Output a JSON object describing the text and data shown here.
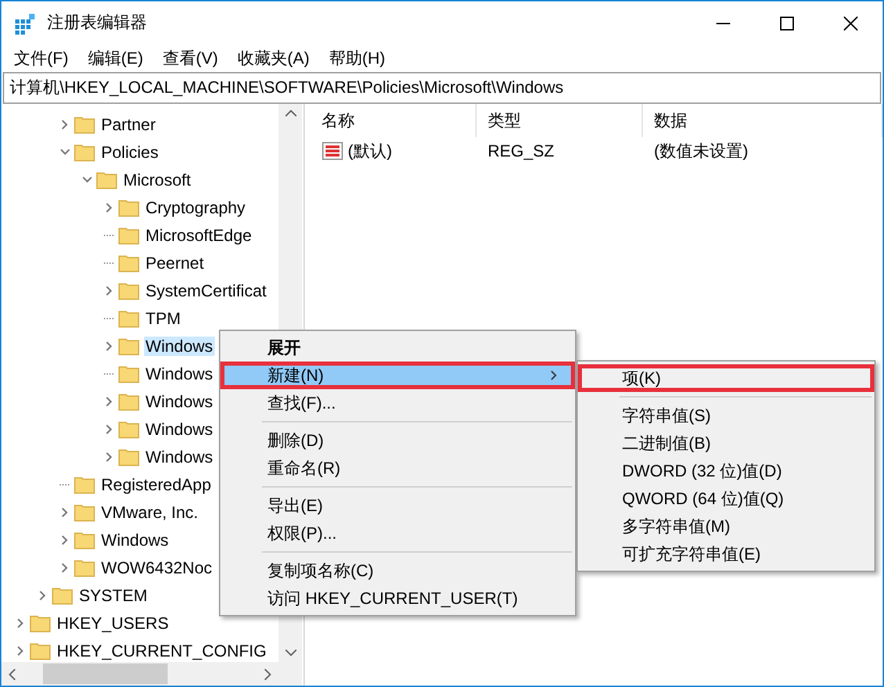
{
  "window": {
    "title": "注册表编辑器"
  },
  "menu_bar": [
    "文件(F)",
    "编辑(E)",
    "查看(V)",
    "收藏夹(A)",
    "帮助(H)"
  ],
  "address_bar": "计算机\\HKEY_LOCAL_MACHINE\\SOFTWARE\\Policies\\Microsoft\\Windows",
  "tree": {
    "software_children": [
      {
        "label": "Partner",
        "kind": "branch",
        "expanded": false,
        "selected": false
      },
      {
        "label": "Policies",
        "kind": "branch",
        "expanded": true,
        "selected": false,
        "children": [
          {
            "label": "Microsoft",
            "kind": "branch",
            "expanded": true,
            "selected": false,
            "children": [
              {
                "label": "Cryptography",
                "kind": "branch",
                "expanded": false,
                "selected": false
              },
              {
                "label": "MicrosoftEdge",
                "kind": "leaf",
                "selected": false
              },
              {
                "label": "Peernet",
                "kind": "leaf",
                "selected": false
              },
              {
                "label": "SystemCertificat",
                "kind": "branch",
                "expanded": false,
                "selected": false
              },
              {
                "label": "TPM",
                "kind": "leaf",
                "selected": false
              },
              {
                "label": "Windows",
                "kind": "branch",
                "expanded": false,
                "selected": true
              },
              {
                "label": "Windows",
                "kind": "leaf",
                "selected": false
              },
              {
                "label": "Windows",
                "kind": "branch",
                "expanded": false,
                "selected": false
              },
              {
                "label": "Windows",
                "kind": "branch",
                "expanded": false,
                "selected": false
              },
              {
                "label": "Windows",
                "kind": "branch",
                "expanded": false,
                "selected": false
              }
            ]
          }
        ]
      },
      {
        "label": "RegisteredApp",
        "kind": "leaf",
        "selected": false
      },
      {
        "label": "VMware, Inc.",
        "kind": "branch",
        "expanded": false,
        "selected": false
      },
      {
        "label": "Windows",
        "kind": "branch",
        "expanded": false,
        "selected": false
      },
      {
        "label": "WOW6432Noc",
        "kind": "branch",
        "expanded": false,
        "selected": false
      }
    ],
    "local_machine_children": [
      {
        "label": "SYSTEM",
        "kind": "branch",
        "expanded": false,
        "selected": false
      }
    ],
    "roots": [
      {
        "label": "HKEY_USERS",
        "kind": "branch",
        "expanded": false,
        "selected": false
      },
      {
        "label": "HKEY_CURRENT_CONFIG",
        "kind": "branch",
        "expanded": false,
        "selected": false
      }
    ]
  },
  "table": {
    "columns": [
      "名称",
      "类型",
      "数据"
    ],
    "rows": [
      {
        "name": "(默认)",
        "type": "REG_SZ",
        "data": "(数值未设置)"
      }
    ]
  },
  "context_menu": {
    "items": [
      {
        "kind": "item",
        "label": "展开",
        "bold": true,
        "selected": false,
        "outlined": false,
        "has_submenu": false
      },
      {
        "kind": "item",
        "label": "新建(N)",
        "bold": false,
        "selected": true,
        "outlined": true,
        "has_submenu": true
      },
      {
        "kind": "item",
        "label": "查找(F)...",
        "bold": false,
        "selected": false,
        "outlined": false,
        "has_submenu": false
      },
      {
        "kind": "separator"
      },
      {
        "kind": "item",
        "label": "删除(D)",
        "bold": false,
        "selected": false,
        "outlined": false,
        "has_submenu": false
      },
      {
        "kind": "item",
        "label": "重命名(R)",
        "bold": false,
        "selected": false,
        "outlined": false,
        "has_submenu": false
      },
      {
        "kind": "separator"
      },
      {
        "kind": "item",
        "label": "导出(E)",
        "bold": false,
        "selected": false,
        "outlined": false,
        "has_submenu": false
      },
      {
        "kind": "item",
        "label": "权限(P)...",
        "bold": false,
        "selected": false,
        "outlined": false,
        "has_submenu": false
      },
      {
        "kind": "separator"
      },
      {
        "kind": "item",
        "label": "复制项名称(C)",
        "bold": false,
        "selected": false,
        "outlined": false,
        "has_submenu": false
      },
      {
        "kind": "item",
        "label": "访问 HKEY_CURRENT_USER(T)",
        "bold": false,
        "selected": false,
        "outlined": false,
        "has_submenu": false
      }
    ]
  },
  "submenu": {
    "items": [
      {
        "kind": "item",
        "label": "项(K)",
        "bold": false,
        "selected": false,
        "outlined": true,
        "has_submenu": false
      },
      {
        "kind": "separator"
      },
      {
        "kind": "item",
        "label": "字符串值(S)",
        "bold": false,
        "selected": false,
        "outlined": false,
        "has_submenu": false
      },
      {
        "kind": "item",
        "label": "二进制值(B)",
        "bold": false,
        "selected": false,
        "outlined": false,
        "has_submenu": false
      },
      {
        "kind": "item",
        "label": "DWORD (32 位)值(D)",
        "bold": false,
        "selected": false,
        "outlined": false,
        "has_submenu": false
      },
      {
        "kind": "item",
        "label": "QWORD (64 位)值(Q)",
        "bold": false,
        "selected": false,
        "outlined": false,
        "has_submenu": false
      },
      {
        "kind": "item",
        "label": "多字符串值(M)",
        "bold": false,
        "selected": false,
        "outlined": false,
        "has_submenu": false
      },
      {
        "kind": "item",
        "label": "可扩充字符串值(E)",
        "bold": false,
        "selected": false,
        "outlined": false,
        "has_submenu": false
      }
    ]
  }
}
